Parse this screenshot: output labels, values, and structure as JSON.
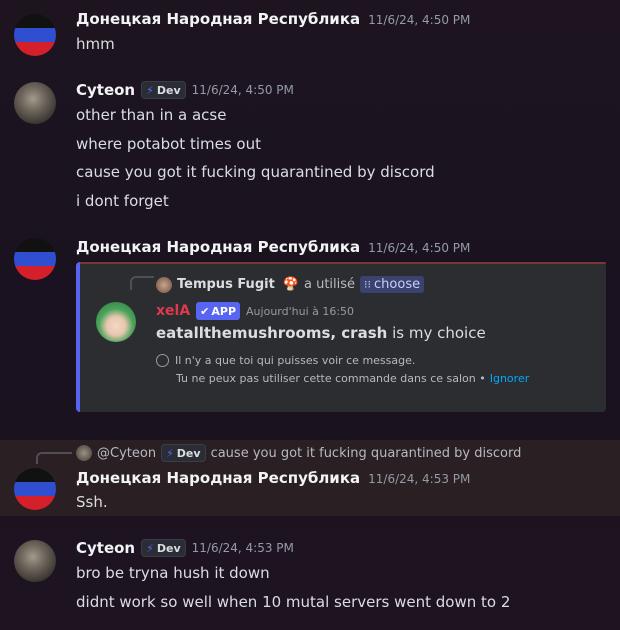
{
  "colors": {
    "flag_top": "#111111",
    "flag_mid": "#2f4fd0",
    "flag_bot": "#d3202a",
    "brand": "#5865f2",
    "link": "#00a8fc",
    "app_name": "#e0384e"
  },
  "messages": [
    {
      "author": "Донецкая Народная Республика",
      "time": "11/6/24, 4:50 PM",
      "lines": [
        "hmm"
      ]
    },
    {
      "author": "Cyteon",
      "badge": "Dev",
      "time": "11/6/24, 4:50 PM",
      "lines": [
        "other than in a acse",
        "where potabot times out",
        "cause you got it fucking quarantined by discord",
        "i dont forget"
      ]
    },
    {
      "author": "Донецкая Народная Республика",
      "time": "11/6/24, 4:50 PM",
      "embed": {
        "user": "Tempus Fugit",
        "used_text": "a utilisé",
        "command": "choose",
        "app_name": "xelA",
        "app_badge": "APP",
        "app_time": "Aujourd'hui à 16:50",
        "result_bold": "eatallthemushrooms, crash",
        "result_rest": " is my choice",
        "notice_1": "Il n'y a que toi qui puisses voir ce message.",
        "notice_2": "Tu ne peux pas utiliser cette commande dans ce salon •",
        "ignore": "Ignorer"
      }
    },
    {
      "reply_user": "@Cyteon",
      "reply_badge": "Dev",
      "reply_text": "cause you got it fucking quarantined by discord",
      "author": "Донецкая Народная Республика",
      "time": "11/6/24, 4:53 PM",
      "lines": [
        "Ssh."
      ]
    },
    {
      "author": "Cyteon",
      "badge": "Dev",
      "time": "11/6/24, 4:53 PM",
      "lines": [
        "bro be tryna hush it down",
        "didnt work so well when 10 mutal servers went down to 2"
      ]
    }
  ]
}
